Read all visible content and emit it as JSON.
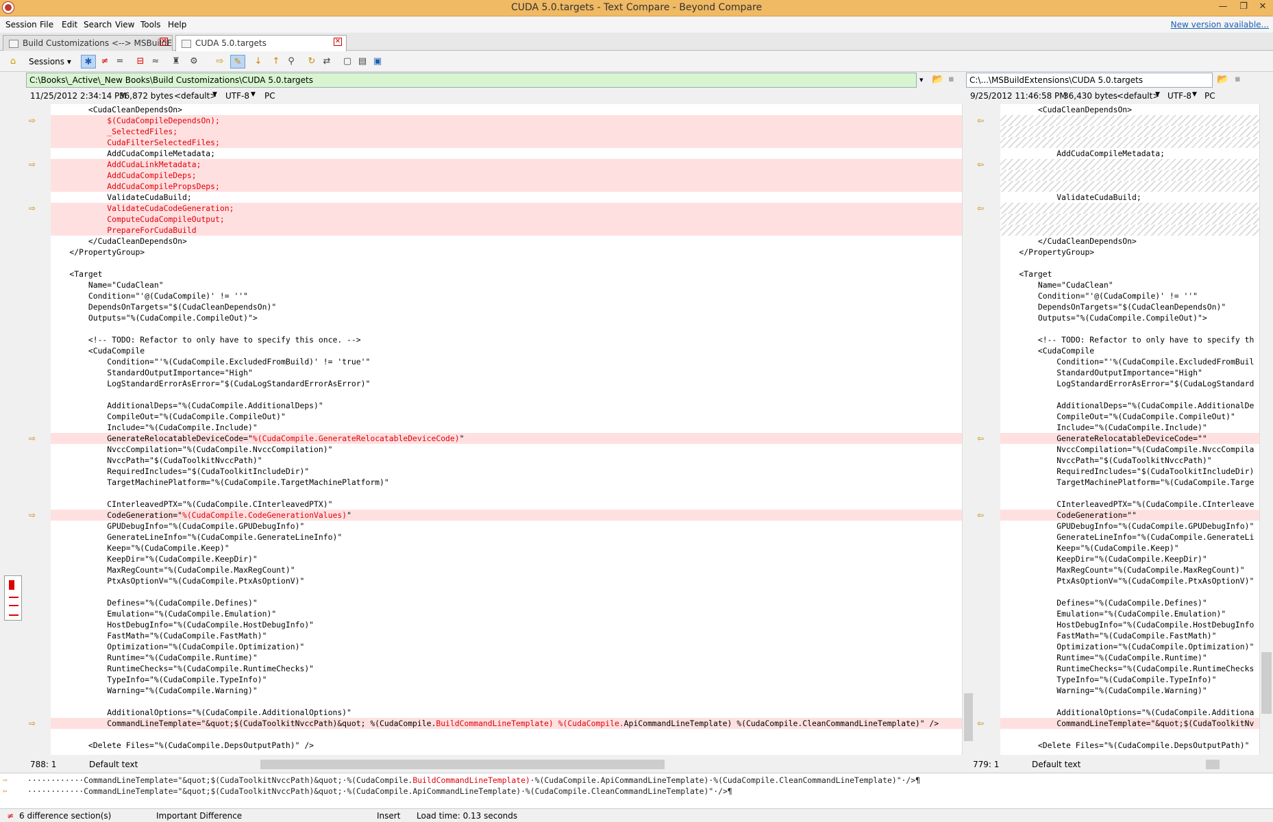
{
  "window": {
    "title": "CUDA 5.0.targets - Text Compare - Beyond Compare",
    "controls": [
      "—",
      "❐",
      "✕"
    ]
  },
  "menu": {
    "items": [
      "Session",
      "File",
      "Edit",
      "Search",
      "View",
      "Tools",
      "Help"
    ],
    "new_version": "New version available..."
  },
  "tabs": [
    {
      "label": "Build Customizations <--> MSBuildE..."
    },
    {
      "label": "CUDA 5.0.targets"
    }
  ],
  "toolbar": {
    "sessions_label": "Sessions"
  },
  "left": {
    "path": "C:\\Books\\_Active\\_New Books\\Build Customizations\\CUDA 5.0.targets",
    "date": "11/25/2012 2:34:14 PM",
    "size": "36,872 bytes",
    "format": "<default>",
    "encoding": "UTF-8",
    "lineend": "PC",
    "position": "788: 1",
    "text_format": "Default text"
  },
  "right": {
    "path": "C:\\...\\MSBuildExtensions\\CUDA 5.0.targets",
    "date": "9/25/2012 11:46:58 PM",
    "size": "36,430 bytes",
    "format": "<default>",
    "encoding": "UTF-8",
    "lineend": "PC",
    "position": "779: 1",
    "text_format": "Default text"
  },
  "left_lines": [
    {
      "text": "        <CudaCleanDependsOn>",
      "type": "normal"
    },
    {
      "text": "            $(CudaCompileDependsOn);",
      "type": "diff",
      "red": true,
      "arrow": true
    },
    {
      "text": "            _SelectedFiles;",
      "type": "diff",
      "red": true
    },
    {
      "text": "            CudaFilterSelectedFiles;",
      "type": "diff",
      "red": true
    },
    {
      "text": "            AddCudaCompileMetadata;",
      "type": "normal"
    },
    {
      "text": "            AddCudaLinkMetadata;",
      "type": "diff",
      "red": true,
      "arrow": true
    },
    {
      "text": "            AddCudaCompileDeps;",
      "type": "diff",
      "red": true
    },
    {
      "text": "            AddCudaCompilePropsDeps;",
      "type": "diff",
      "red": true
    },
    {
      "text": "            ValidateCudaBuild;",
      "type": "normal"
    },
    {
      "text": "            ValidateCudaCodeGeneration;",
      "type": "diff",
      "red": true,
      "arrow": true
    },
    {
      "text": "            ComputeCudaCompileOutput;",
      "type": "diff",
      "red": true
    },
    {
      "text": "            PrepareForCudaBuild",
      "type": "diff",
      "red": true
    },
    {
      "text": "        </CudaCleanDependsOn>",
      "type": "normal"
    },
    {
      "text": "    </PropertyGroup>",
      "type": "normal"
    },
    {
      "text": "",
      "type": "normal"
    },
    {
      "text": "    <Target",
      "type": "normal"
    },
    {
      "text": "        Name=\"CudaClean\"",
      "type": "normal"
    },
    {
      "text": "        Condition=\"'@(CudaCompile)' != ''\"",
      "type": "normal"
    },
    {
      "text": "        DependsOnTargets=\"$(CudaCleanDependsOn)\"",
      "type": "normal"
    },
    {
      "text": "        Outputs=\"%(CudaCompile.CompileOut)\">",
      "type": "normal"
    },
    {
      "text": "",
      "type": "normal"
    },
    {
      "text": "        <!-- TODO: Refactor to only have to specify this once. -->",
      "type": "normal"
    },
    {
      "text": "        <CudaCompile",
      "type": "normal"
    },
    {
      "text": "            Condition=\"'%(CudaCompile.ExcludedFromBuild)' != 'true'\"",
      "type": "normal"
    },
    {
      "text": "            StandardOutputImportance=\"High\"",
      "type": "normal"
    },
    {
      "text": "            LogStandardErrorAsError=\"$(CudaLogStandardErrorAsError)\"",
      "type": "normal"
    },
    {
      "text": "",
      "type": "normal"
    },
    {
      "text": "            AdditionalDeps=\"%(CudaCompile.AdditionalDeps)\"",
      "type": "normal"
    },
    {
      "text": "            CompileOut=\"%(CudaCompile.CompileOut)\"",
      "type": "normal"
    },
    {
      "text": "            Include=\"%(CudaCompile.Include)\"",
      "type": "normal"
    },
    {
      "text": "            GenerateRelocatableDeviceCode=\"%(CudaCompile.GenerateRelocatableDeviceCode)\"",
      "type": "diff",
      "arrow": true,
      "pre": "            GenerateRelocatableDeviceCode=\"",
      "redpart": "%(CudaCompile.GenerateRelocatableDeviceCode)",
      "post": "\""
    },
    {
      "text": "            NvccCompilation=\"%(CudaCompile.NvccCompilation)\"",
      "type": "normal"
    },
    {
      "text": "            NvccPath=\"$(CudaToolkitNvccPath)\"",
      "type": "normal"
    },
    {
      "text": "            RequiredIncludes=\"$(CudaToolkitIncludeDir)\"",
      "type": "normal"
    },
    {
      "text": "            TargetMachinePlatform=\"%(CudaCompile.TargetMachinePlatform)\"",
      "type": "normal"
    },
    {
      "text": "",
      "type": "normal"
    },
    {
      "text": "            CInterleavedPTX=\"%(CudaCompile.CInterleavedPTX)\"",
      "type": "normal"
    },
    {
      "text": "            CodeGeneration=\"%(CudaCompile.CodeGenerationValues)\"",
      "type": "diff",
      "arrow": true,
      "pre": "            CodeGeneration=\"",
      "redpart": "%(CudaCompile.CodeGenerationValues)",
      "post": "\""
    },
    {
      "text": "            GPUDebugInfo=\"%(CudaCompile.GPUDebugInfo)\"",
      "type": "normal"
    },
    {
      "text": "            GenerateLineInfo=\"%(CudaCompile.GenerateLineInfo)\"",
      "type": "normal"
    },
    {
      "text": "            Keep=\"%(CudaCompile.Keep)\"",
      "type": "normal"
    },
    {
      "text": "            KeepDir=\"%(CudaCompile.KeepDir)\"",
      "type": "normal"
    },
    {
      "text": "            MaxRegCount=\"%(CudaCompile.MaxRegCount)\"",
      "type": "normal"
    },
    {
      "text": "            PtxAsOptionV=\"%(CudaCompile.PtxAsOptionV)\"",
      "type": "normal"
    },
    {
      "text": "",
      "type": "normal"
    },
    {
      "text": "            Defines=\"%(CudaCompile.Defines)\"",
      "type": "normal"
    },
    {
      "text": "            Emulation=\"%(CudaCompile.Emulation)\"",
      "type": "normal"
    },
    {
      "text": "            HostDebugInfo=\"%(CudaCompile.HostDebugInfo)\"",
      "type": "normal"
    },
    {
      "text": "            FastMath=\"%(CudaCompile.FastMath)\"",
      "type": "normal"
    },
    {
      "text": "            Optimization=\"%(CudaCompile.Optimization)\"",
      "type": "normal"
    },
    {
      "text": "            Runtime=\"%(CudaCompile.Runtime)\"",
      "type": "normal"
    },
    {
      "text": "            RuntimeChecks=\"%(CudaCompile.RuntimeChecks)\"",
      "type": "normal"
    },
    {
      "text": "            TypeInfo=\"%(CudaCompile.TypeInfo)\"",
      "type": "normal"
    },
    {
      "text": "            Warning=\"%(CudaCompile.Warning)\"",
      "type": "normal"
    },
    {
      "text": "",
      "type": "normal"
    },
    {
      "text": "            AdditionalOptions=\"%(CudaCompile.AdditionalOptions)\"",
      "type": "normal"
    },
    {
      "text": "            CommandLineTemplate=\"&quot;$(CudaToolkitNvccPath)&quot; %(CudaCompile.BuildCommandLineTemplate) %(CudaCompile.ApiCommandLineTemplate) %(CudaCompile.CleanCommandLineTemplate)\" />",
      "type": "diff",
      "arrow": true,
      "pre": "            CommandLineTemplate=\"&quot;$(CudaToolkitNvccPath)&quot; %(CudaCompile.",
      "redpart": "BuildCommandLineTemplate) %(CudaCompile.",
      "post": "ApiCommandLineTemplate) %(CudaCompile.CleanCommandLineTemplate)\" />"
    },
    {
      "text": "",
      "type": "normal"
    },
    {
      "text": "        <Delete Files=\"%(CudaCompile.DepsOutputPath)\" />",
      "type": "normal"
    }
  ],
  "right_lines": [
    {
      "text": "        <CudaCleanDependsOn>",
      "type": "normal"
    },
    {
      "text": "",
      "type": "hatch",
      "arrow": true
    },
    {
      "text": "",
      "type": "hatch"
    },
    {
      "text": "",
      "type": "hatch"
    },
    {
      "text": "            AddCudaCompileMetadata;",
      "type": "normal"
    },
    {
      "text": "",
      "type": "hatch",
      "arrow": true
    },
    {
      "text": "",
      "type": "hatch"
    },
    {
      "text": "",
      "type": "hatch"
    },
    {
      "text": "            ValidateCudaBuild;",
      "type": "normal"
    },
    {
      "text": "",
      "type": "hatch",
      "arrow": true
    },
    {
      "text": "",
      "type": "hatch"
    },
    {
      "text": "",
      "type": "hatch"
    },
    {
      "text": "        </CudaCleanDependsOn>",
      "type": "normal"
    },
    {
      "text": "    </PropertyGroup>",
      "type": "normal"
    },
    {
      "text": "",
      "type": "normal"
    },
    {
      "text": "    <Target",
      "type": "normal"
    },
    {
      "text": "        Name=\"CudaClean\"",
      "type": "normal"
    },
    {
      "text": "        Condition=\"'@(CudaCompile)' != ''\"",
      "type": "normal"
    },
    {
      "text": "        DependsOnTargets=\"$(CudaCleanDependsOn)\"",
      "type": "normal"
    },
    {
      "text": "        Outputs=\"%(CudaCompile.CompileOut)\">",
      "type": "normal"
    },
    {
      "text": "",
      "type": "normal"
    },
    {
      "text": "        <!-- TODO: Refactor to only have to specify th",
      "type": "normal"
    },
    {
      "text": "        <CudaCompile",
      "type": "normal"
    },
    {
      "text": "            Condition=\"'%(CudaCompile.ExcludedFromBuil",
      "type": "normal"
    },
    {
      "text": "            StandardOutputImportance=\"High\"",
      "type": "normal"
    },
    {
      "text": "            LogStandardErrorAsError=\"$(CudaLogStandard",
      "type": "normal"
    },
    {
      "text": "",
      "type": "normal"
    },
    {
      "text": "            AdditionalDeps=\"%(CudaCompile.AdditionalDe",
      "type": "normal"
    },
    {
      "text": "            CompileOut=\"%(CudaCompile.CompileOut)\"",
      "type": "normal"
    },
    {
      "text": "            Include=\"%(CudaCompile.Include)\"",
      "type": "normal"
    },
    {
      "text": "            GenerateRelocatableDeviceCode=\"\"",
      "type": "diff",
      "arrow": true
    },
    {
      "text": "            NvccCompilation=\"%(CudaCompile.NvccCompila",
      "type": "normal"
    },
    {
      "text": "            NvccPath=\"$(CudaToolkitNvccPath)\"",
      "type": "normal"
    },
    {
      "text": "            RequiredIncludes=\"$(CudaToolkitIncludeDir)",
      "type": "normal"
    },
    {
      "text": "            TargetMachinePlatform=\"%(CudaCompile.Targe",
      "type": "normal"
    },
    {
      "text": "",
      "type": "normal"
    },
    {
      "text": "            CInterleavedPTX=\"%(CudaCompile.CInterleave",
      "type": "normal"
    },
    {
      "text": "            CodeGeneration=\"\"",
      "type": "diff",
      "arrow": true
    },
    {
      "text": "            GPUDebugInfo=\"%(CudaCompile.GPUDebugInfo)\"",
      "type": "normal"
    },
    {
      "text": "            GenerateLineInfo=\"%(CudaCompile.GenerateLi",
      "type": "normal"
    },
    {
      "text": "            Keep=\"%(CudaCompile.Keep)\"",
      "type": "normal"
    },
    {
      "text": "            KeepDir=\"%(CudaCompile.KeepDir)\"",
      "type": "normal"
    },
    {
      "text": "            MaxRegCount=\"%(CudaCompile.MaxRegCount)\"",
      "type": "normal"
    },
    {
      "text": "            PtxAsOptionV=\"%(CudaCompile.PtxAsOptionV)\"",
      "type": "normal"
    },
    {
      "text": "",
      "type": "normal"
    },
    {
      "text": "            Defines=\"%(CudaCompile.Defines)\"",
      "type": "normal"
    },
    {
      "text": "            Emulation=\"%(CudaCompile.Emulation)\"",
      "type": "normal"
    },
    {
      "text": "            HostDebugInfo=\"%(CudaCompile.HostDebugInfo",
      "type": "normal"
    },
    {
      "text": "            FastMath=\"%(CudaCompile.FastMath)\"",
      "type": "normal"
    },
    {
      "text": "            Optimization=\"%(CudaCompile.Optimization)\"",
      "type": "normal"
    },
    {
      "text": "            Runtime=\"%(CudaCompile.Runtime)\"",
      "type": "normal"
    },
    {
      "text": "            RuntimeChecks=\"%(CudaCompile.RuntimeChecks",
      "type": "normal"
    },
    {
      "text": "            TypeInfo=\"%(CudaCompile.TypeInfo)\"",
      "type": "normal"
    },
    {
      "text": "            Warning=\"%(CudaCompile.Warning)\"",
      "type": "normal"
    },
    {
      "text": "",
      "type": "normal"
    },
    {
      "text": "            AdditionalOptions=\"%(CudaCompile.Additiona",
      "type": "normal"
    },
    {
      "text": "            CommandLineTemplate=\"&quot;$(CudaToolkitNv",
      "type": "diff",
      "arrow": true
    },
    {
      "text": "",
      "type": "normal"
    },
    {
      "text": "        <Delete Files=\"%(CudaCompile.DepsOutputPath)\"",
      "type": "normal"
    }
  ],
  "bottom": {
    "line1": "············CommandLineTemplate=\"&quot;$(CudaToolkitNvccPath)&quot;·%(CudaCompile.BuildCommandLineTemplate)·%(CudaCompile.ApiCommandLineTemplate)·%(CudaCompile.CleanCommandLineTemplate)\"·/>¶",
    "line2": "············CommandLineTemplate=\"&quot;$(CudaToolkitNvccPath)&quot;·%(CudaCompile.ApiCommandLineTemplate)·%(CudaCompile.CleanCommandLineTemplate)\"·/>¶"
  },
  "status": {
    "differences": "6 difference section(s)",
    "importance": "Important Difference",
    "mode": "Insert",
    "load_time": "Load time: 0.13 seconds"
  }
}
